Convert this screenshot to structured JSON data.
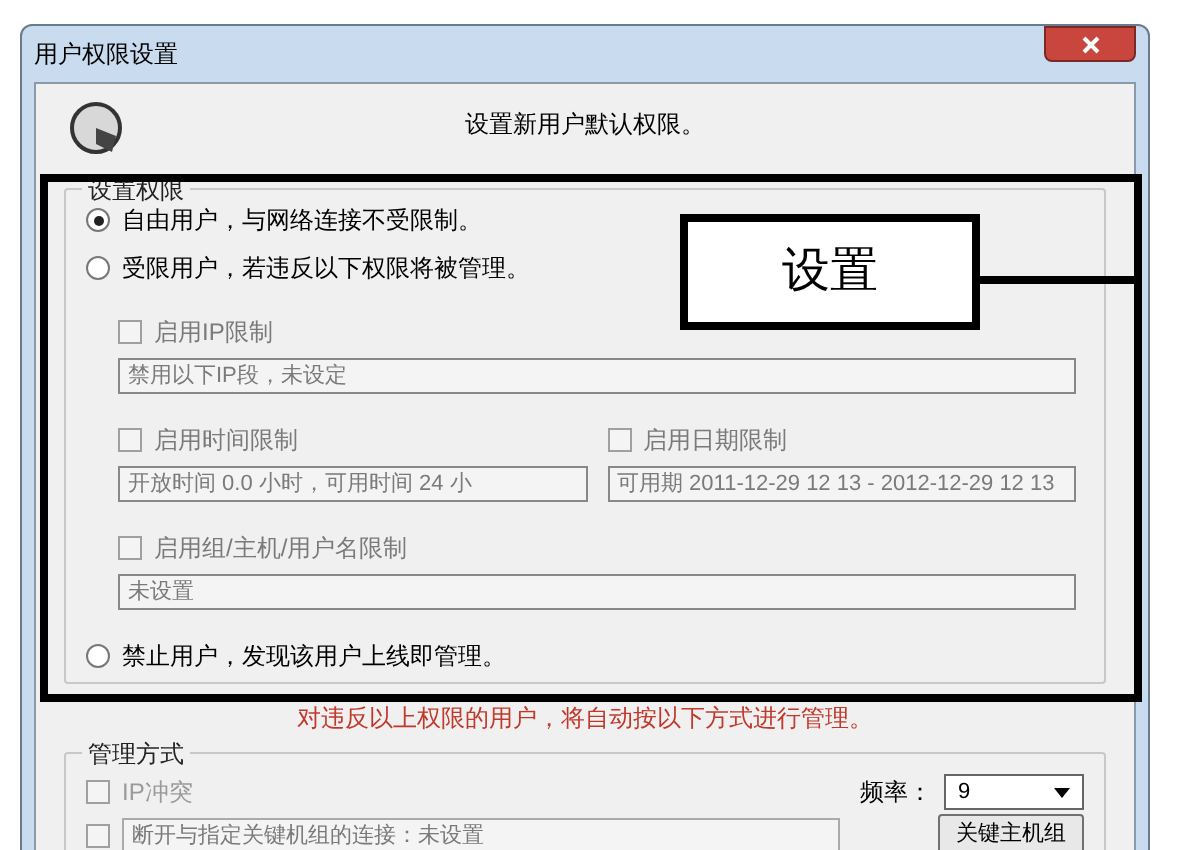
{
  "window": {
    "title": "用户权限设置"
  },
  "header": {
    "text": "设置新用户默认权限。"
  },
  "permissions": {
    "title": "设置权限",
    "items": [
      {
        "kind": "radio",
        "label": "自由用户，与网络连接不受限制。",
        "selected": true
      },
      {
        "kind": "radio",
        "label": "受限用户，若违反以下权限将被管理。",
        "selected": false
      },
      {
        "kind": "restrictions",
        "entries": [
          {
            "label": "启用IP限制",
            "checked": false,
            "disabled": true,
            "value": "禁用以下IP段，未设定"
          }
        ]
      },
      {
        "kind": "restrictions",
        "entries": [
          {
            "label": "启用时间限制",
            "checked": false,
            "disabled": true,
            "value": "开放时间 0.0 小时，可用时间 24 小"
          },
          {
            "label": "启用日期限制",
            "checked": false,
            "disabled": true,
            "value": "可用期 2011-12-29 12 13 - 2012-12-29 12 13"
          }
        ]
      },
      {
        "kind": "restrictions",
        "entries": [
          {
            "label": "启用组/主机/用户名限制",
            "checked": false,
            "disabled": true,
            "value": "未设置"
          }
        ]
      },
      {
        "kind": "radio",
        "label": "禁止用户，发现该用户上线即管理。",
        "selected": false
      }
    ]
  },
  "annotation": {
    "label": "设置"
  },
  "notice": "对违反以上权限的用户，将自动按以下方式进行管理。",
  "management": {
    "title": "管理方式",
    "options": [
      {
        "label": "IP冲突",
        "checked": false,
        "disabled": true
      },
      {
        "value": "断开与指定关键机组的连接：未设置",
        "checked": false,
        "disabled": true
      }
    ],
    "frequency": {
      "label": "频率：",
      "value": "9"
    },
    "button": "关键主机组"
  }
}
